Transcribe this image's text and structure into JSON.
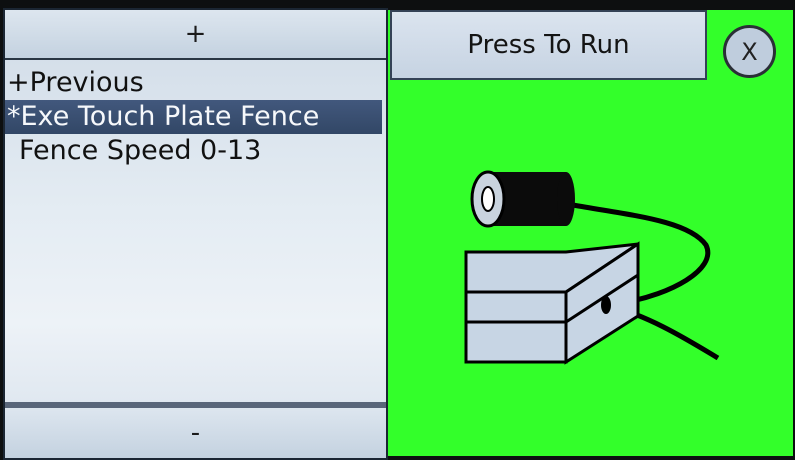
{
  "left_panel": {
    "scroll_up_label": "+",
    "scroll_down_label": "-",
    "items": [
      {
        "label": "+Previous"
      },
      {
        "label": "*Exe Touch Plate Fence"
      },
      {
        "label": " Fence Speed 0-13"
      }
    ]
  },
  "right_panel": {
    "run_label": "Press To Run",
    "close_label": "X"
  },
  "colors": {
    "accent_green": "#33ff2a",
    "selection_blue": "#3a5074"
  }
}
